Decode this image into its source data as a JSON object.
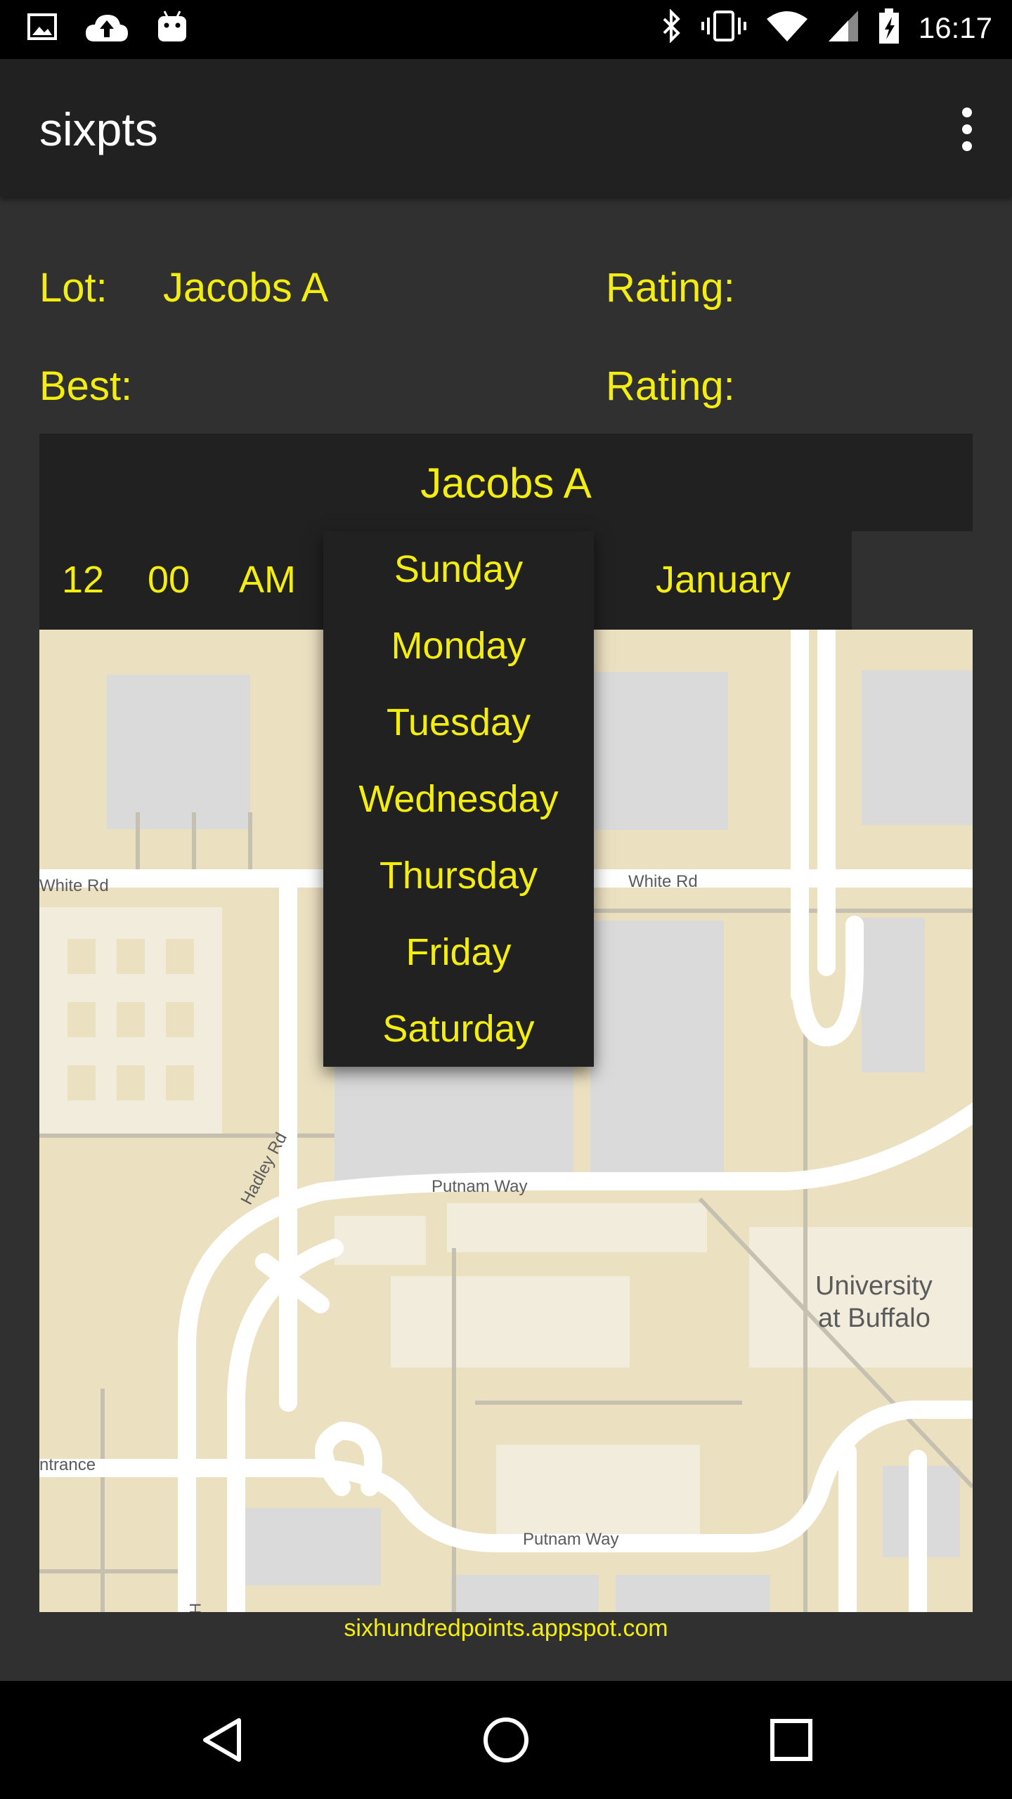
{
  "status_bar": {
    "time": "16:17",
    "left_icons": [
      "image-icon",
      "cloud-upload-icon",
      "android-icon"
    ],
    "right_icons": [
      "bluetooth-icon",
      "vibrate-icon",
      "wifi-icon",
      "cellular-icon",
      "battery-icon"
    ]
  },
  "app_bar": {
    "title": "sixpts",
    "menu_icon": "overflow-menu-icon"
  },
  "info": {
    "lot_label": "Lot:",
    "lot_value": "Jacobs A",
    "rating_label_1": "Rating:",
    "best_label": "Best:",
    "rating_label_2": "Rating:"
  },
  "card": {
    "title": "Jacobs A",
    "hour": "12",
    "minute": "00",
    "ampm": "AM",
    "month": "January"
  },
  "day_dropdown": {
    "options": [
      "Sunday",
      "Monday",
      "Tuesday",
      "Wednesday",
      "Thursday",
      "Friday",
      "Saturday"
    ]
  },
  "map": {
    "labels": {
      "white_rd_left": "White Rd",
      "white_rd_right": "White Rd",
      "hadley_rd": "Hadley Rd",
      "putnam_way_top": "Putnam Way",
      "putnam_way_bottom": "Putnam Way",
      "university_line1": "University",
      "university_line2": "at Buffalo",
      "entrance": "ntrance",
      "h": "H"
    }
  },
  "footer": {
    "link": "sixhundredpoints.appspot.com"
  },
  "nav_bar": {
    "icons": [
      "back-icon",
      "home-icon",
      "recents-icon"
    ]
  },
  "colors": {
    "accent": "#f4ee10",
    "background": "#303030",
    "panel": "#212121",
    "map_land": "#ebe0c0",
    "map_road": "#ffffff",
    "map_building": "#dadada"
  }
}
